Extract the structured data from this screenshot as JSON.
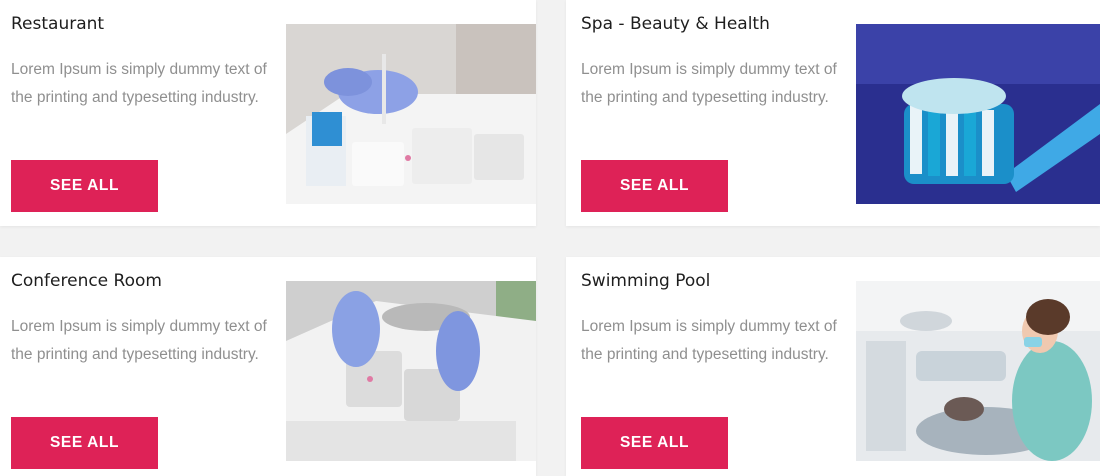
{
  "accent_color": "#de2257",
  "cards": [
    {
      "title": "Restaurant",
      "description": "Lorem Ipsum is simply dummy text of the printing and typesetting industry.",
      "button_label": "SEE ALL",
      "image": "gloved-hand-lab-tray-photo"
    },
    {
      "title": "Spa - Beauty & Health",
      "description": "Lorem Ipsum is simply dummy text of the printing and typesetting industry.",
      "button_label": "SEE ALL",
      "image": "toothbrush-with-toothpaste-photo"
    },
    {
      "title": "Conference Room",
      "description": "Lorem Ipsum is simply dummy text of the printing and typesetting industry.",
      "button_label": "SEE ALL",
      "image": "gloved-hands-sample-tray-photo"
    },
    {
      "title": "Swimming Pool",
      "description": "Lorem Ipsum is simply dummy text of the printing and typesetting industry.",
      "button_label": "SEE ALL",
      "image": "dentist-treating-patient-photo"
    }
  ]
}
